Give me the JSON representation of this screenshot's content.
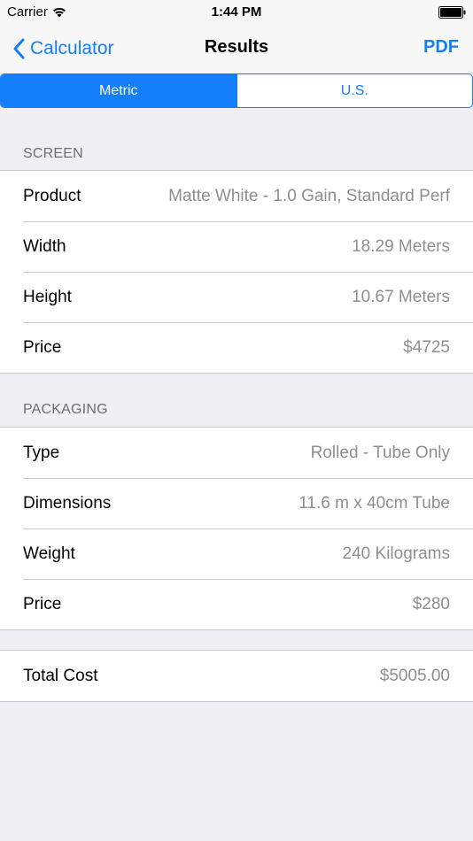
{
  "status_bar": {
    "carrier": "Carrier",
    "time": "1:44 PM"
  },
  "nav": {
    "back_label": "Calculator",
    "title": "Results",
    "action_label": "PDF"
  },
  "units": {
    "options": [
      "Metric",
      "U.S."
    ],
    "selected": "Metric"
  },
  "screen": {
    "header": "SCREEN",
    "rows": [
      {
        "label": "Product",
        "value": "Matte White - 1.0 Gain, Standard Perf"
      },
      {
        "label": "Width",
        "value": "18.29 Meters"
      },
      {
        "label": "Height",
        "value": "10.67 Meters"
      },
      {
        "label": "Price",
        "value": "$4725"
      }
    ]
  },
  "packaging": {
    "header": "PACKAGING",
    "rows": [
      {
        "label": "Type",
        "value": "Rolled - Tube Only"
      },
      {
        "label": "Dimensions",
        "value": "11.6 m x 40cm Tube"
      },
      {
        "label": "Weight",
        "value": "240 Kilograms"
      },
      {
        "label": "Price",
        "value": "$280"
      }
    ]
  },
  "total": {
    "label": "Total Cost",
    "value": "$5005.00"
  },
  "colors": {
    "accent": "#147efb",
    "background": "#efeff4",
    "secondary_text": "#8e8e93"
  }
}
